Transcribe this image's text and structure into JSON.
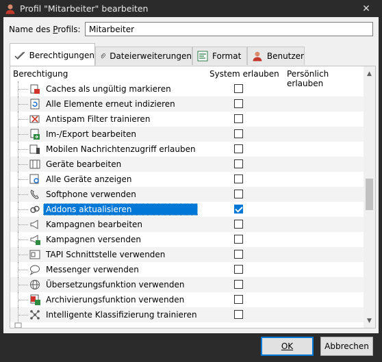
{
  "window": {
    "title": "Profil \"Mitarbeiter\" bearbeiten",
    "close_glyph": "✕"
  },
  "profile": {
    "name_label_pre": "Name des ",
    "name_label_ul": "P",
    "name_label_post": "rofils:",
    "name_value": "Mitarbeiter"
  },
  "tabs": [
    {
      "label": "Berechtigungen",
      "icon": "checkmark-icon",
      "active": true
    },
    {
      "label": "Dateierweiterungen",
      "icon": "paperclip-icon",
      "active": false
    },
    {
      "label": "Format",
      "icon": "format-icon",
      "active": false
    },
    {
      "label": "Benutzer",
      "icon": "user-icon",
      "active": false
    }
  ],
  "columns": {
    "permission": "Berechtigung",
    "system": "System erlauben",
    "personal": "Persönlich erlauben"
  },
  "permissions": [
    {
      "label": "Caches als ungültig markieren",
      "icon": "cache-invalidate-icon",
      "checked": false
    },
    {
      "label": "Alle Elemente erneut indizieren",
      "icon": "reindex-icon",
      "checked": false
    },
    {
      "label": "Antispam Filter trainieren",
      "icon": "antispam-icon",
      "checked": false
    },
    {
      "label": "Im-/Export bearbeiten",
      "icon": "import-export-icon",
      "checked": false
    },
    {
      "label": "Mobilen Nachrichtenzugriff erlauben",
      "icon": "mobile-access-icon",
      "checked": false
    },
    {
      "label": "Geräte bearbeiten",
      "icon": "devices-icon",
      "checked": false
    },
    {
      "label": "Alle Geräte anzeigen",
      "icon": "devices-view-icon",
      "checked": false
    },
    {
      "label": "Softphone verwenden",
      "icon": "phone-icon",
      "checked": false
    },
    {
      "label": "Addons aktualisieren",
      "icon": "addons-icon",
      "checked": true,
      "selected": true
    },
    {
      "label": "Kampagnen bearbeiten",
      "icon": "megaphone-icon",
      "checked": false
    },
    {
      "label": "Kampagnen versenden",
      "icon": "megaphone-send-icon",
      "checked": false
    },
    {
      "label": "TAPI Schnittstelle verwenden",
      "icon": "tapi-icon",
      "checked": false
    },
    {
      "label": "Messenger verwenden",
      "icon": "chat-icon",
      "checked": false
    },
    {
      "label": "Übersetzungsfunktion verwenden",
      "icon": "globe-icon",
      "checked": false
    },
    {
      "label": "Archivierungsfunktion verwenden",
      "icon": "archive-icon",
      "checked": false
    },
    {
      "label": "Intelligente Klassifizierung trainieren",
      "icon": "network-icon",
      "checked": false
    }
  ],
  "buttons": {
    "ok": "OK",
    "cancel": "Abbrechen"
  },
  "colors": {
    "selection": "#0078d7",
    "titlebar": "#2b2b2b"
  }
}
